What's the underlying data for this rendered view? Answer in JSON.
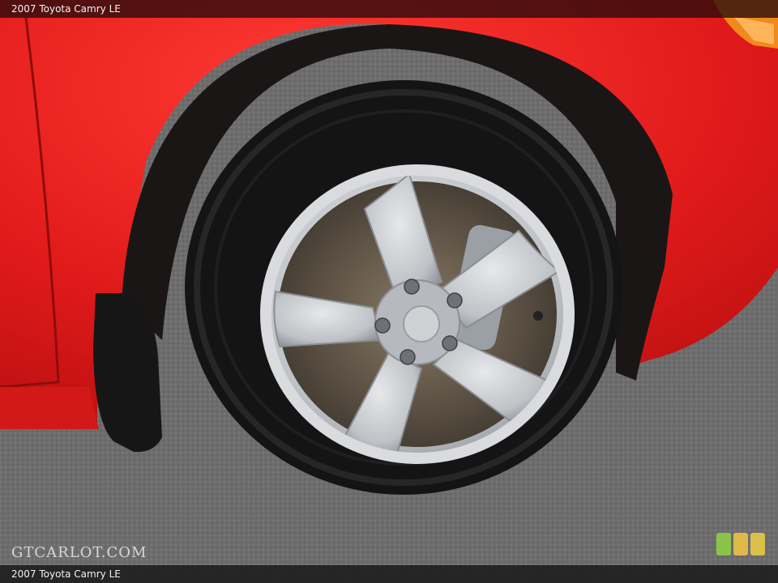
{
  "header": {
    "caption": "2007 Toyota Camry LE"
  },
  "footer": {
    "caption": "2007 Toyota Camry LE"
  },
  "watermark": {
    "text": "GTCARLOT.COM"
  },
  "logo": {
    "name": "gtcarlot-logo-icon",
    "colors": [
      "#8bc34a",
      "#e0b84a",
      "#d9c04a"
    ]
  },
  "colors": {
    "body_paint": "#e41f1f",
    "tire": "#141414",
    "rim": "#c9cbcf",
    "asphalt": "#6f6f6f"
  }
}
